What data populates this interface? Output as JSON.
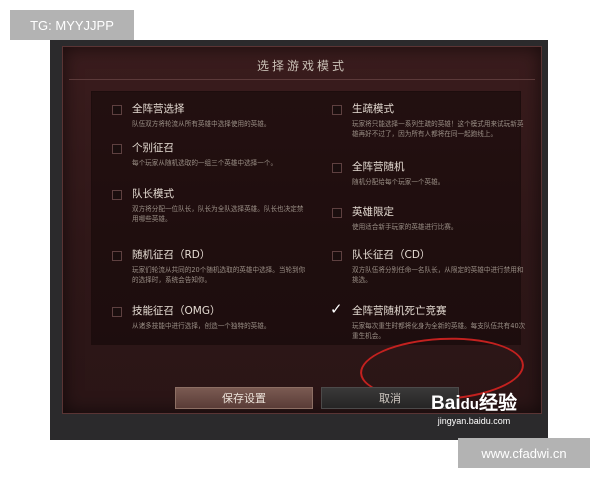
{
  "overlay": {
    "top_tag": "TG: MYYJJPP",
    "bottom_tag": "www.cfadwi.cn",
    "baidu_brand_left": "Bai",
    "baidu_paw": "du",
    "baidu_brand_right": "经验",
    "baidu_url": "jingyan.baidu.com"
  },
  "dialog": {
    "title": "选择游戏模式",
    "options_left": [
      {
        "name": "全阵营选择",
        "desc": "队伍双方将轮流从所有英雄中选择使用的英雄。",
        "checked": false
      },
      {
        "name": "个别征召",
        "desc": "每个玩家从随机选取的一组三个英雄中选择一个。",
        "checked": false
      },
      {
        "name": "队长模式",
        "desc": "双方将分配一位队长，队长为全队选择英雄。队长也决定禁用哪些英雄。",
        "checked": false
      },
      {
        "name": "随机征召（RD）",
        "desc": "玩家们轮流从共同的20个随机选取的英雄中选择。当轮到你的选择时，系统会告知你。",
        "checked": false
      },
      {
        "name": "技能征召（OMG）",
        "desc": "从诸多技能中进行选择，创造一个独特的英雄。",
        "checked": false
      }
    ],
    "options_right": [
      {
        "name": "生疏模式",
        "desc": "玩家将只能选择一系列生疏的英雄！这个模式用来试玩新英雄再好不过了，因为所有人都将在同一起跑线上。",
        "checked": false
      },
      {
        "name": "全阵营随机",
        "desc": "随机分配给每个玩家一个英雄。",
        "checked": false
      },
      {
        "name": "英雄限定",
        "desc": "使用适合新手玩家的英雄进行比赛。",
        "checked": false
      },
      {
        "name": "队长征召（CD）",
        "desc": "双方队伍将分别任命一名队长，从限定的英雄中进行禁用和挑选。",
        "checked": false
      },
      {
        "name": "全阵营随机死亡竞赛",
        "desc": "玩家每次重生时都将化身为全新的英雄。每支队伍共有40次重生机会。",
        "checked": true
      }
    ],
    "save_label": "保存设置",
    "cancel_label": "取消"
  },
  "colors": {
    "dialog_bg": "#2f1718",
    "highlight_circle": "#c3211f"
  }
}
